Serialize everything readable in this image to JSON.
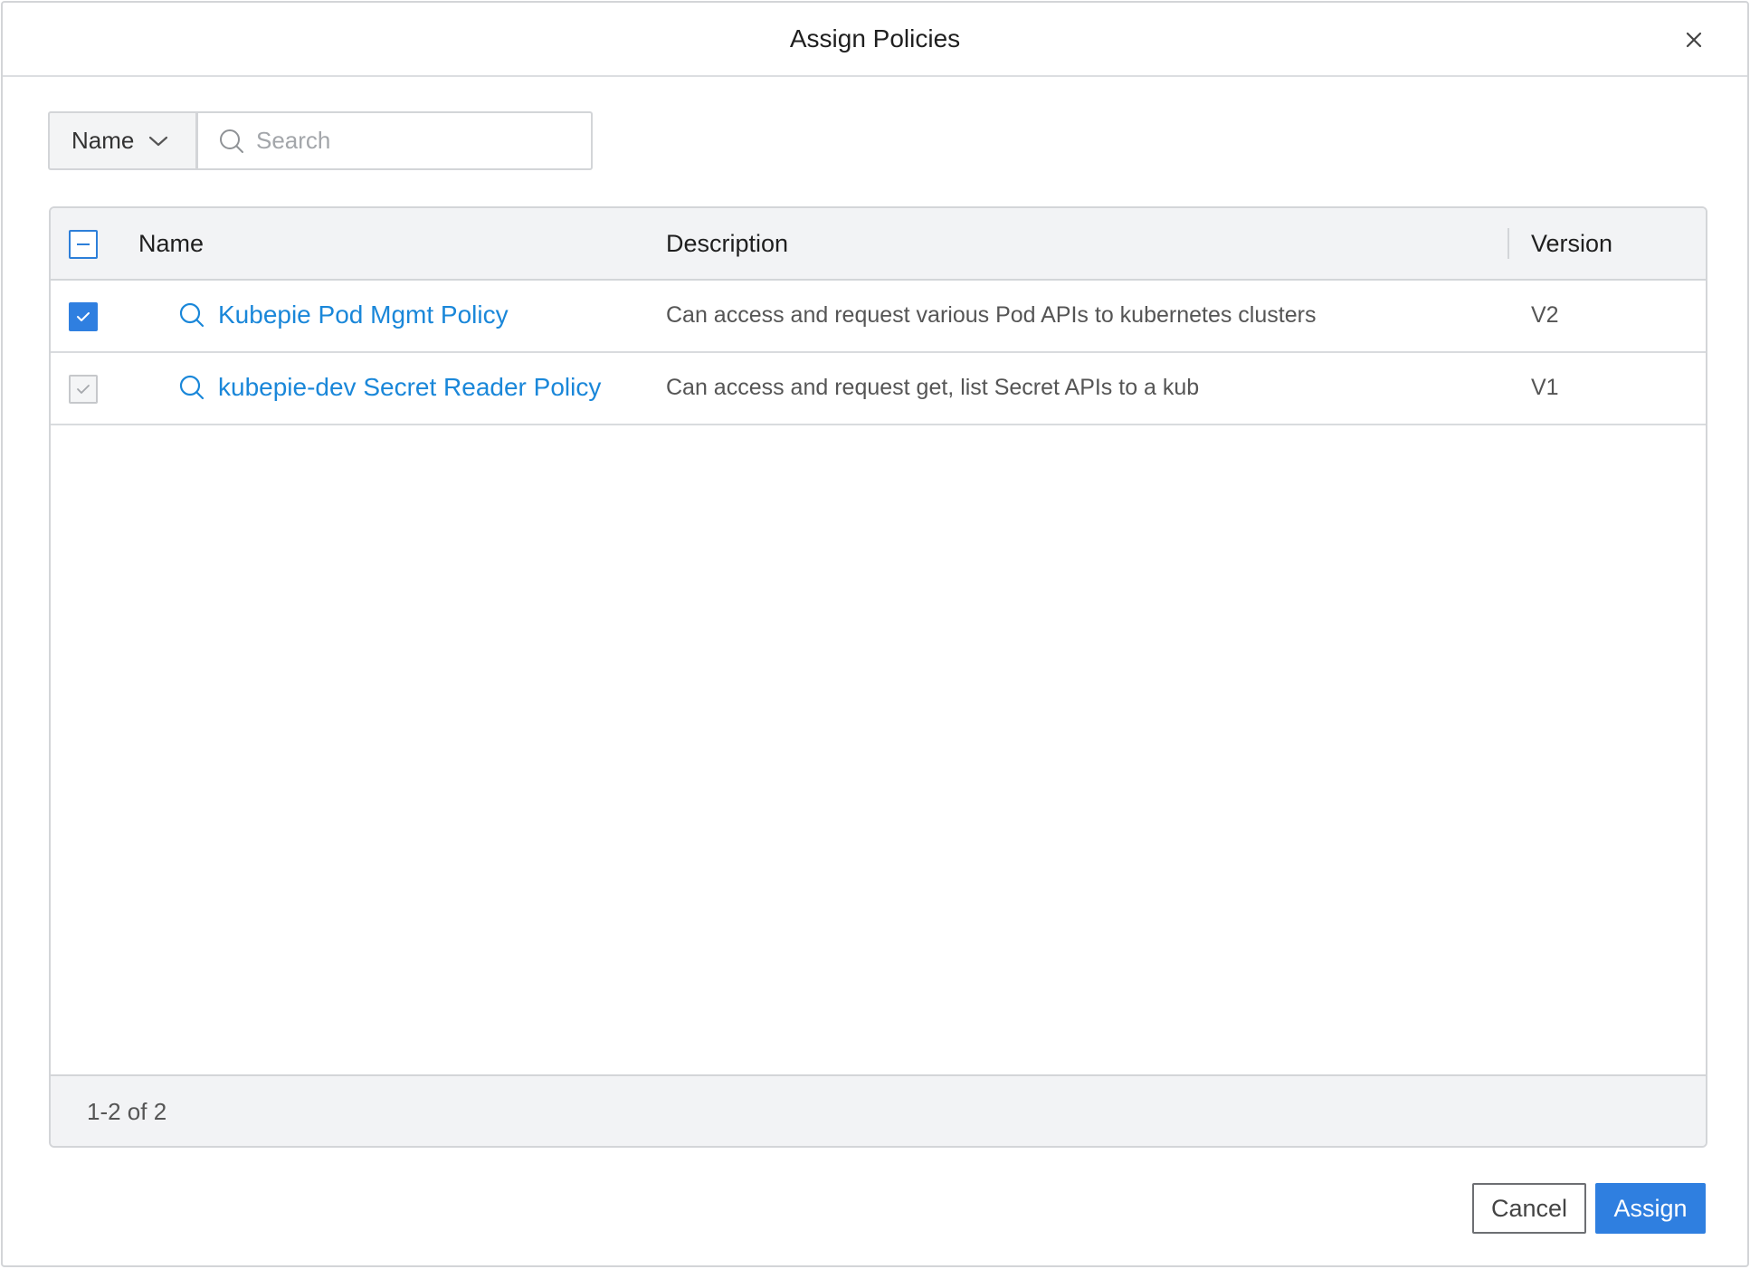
{
  "dialog": {
    "title": "Assign Policies"
  },
  "filter": {
    "field_label": "Name",
    "search_placeholder": "Search",
    "search_value": ""
  },
  "table": {
    "columns": {
      "name": "Name",
      "description": "Description",
      "version": "Version"
    },
    "select_all_state": "indeterminate",
    "rows": [
      {
        "checked": true,
        "disabled": false,
        "name": "Kubepie Pod Mgmt Policy",
        "description": "Can access and request various Pod APIs to kubernetes clusters",
        "version": "V2"
      },
      {
        "checked": true,
        "disabled": true,
        "name": "kubepie-dev Secret Reader Policy",
        "description": "Can access and request get, list Secret APIs to a kub",
        "version": "V1"
      }
    ],
    "pagination": "1-2 of 2"
  },
  "footer": {
    "cancel_label": "Cancel",
    "assign_label": "Assign"
  },
  "colors": {
    "accent": "#2f7fe0",
    "link": "#1a87d9",
    "header_bg": "#f2f3f5",
    "border": "#d3d5d8"
  }
}
